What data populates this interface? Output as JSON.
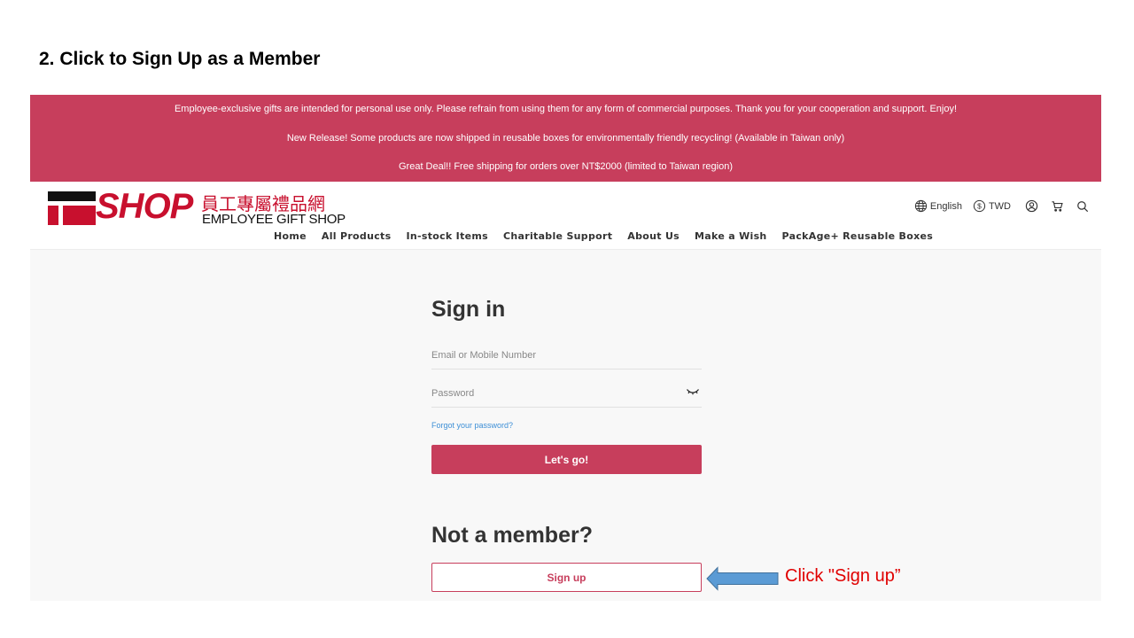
{
  "slide": {
    "title": "2. Click to Sign Up as a Member",
    "callout": "Click \"Sign up”"
  },
  "announcements": [
    "Employee-exclusive gifts are intended for personal use only. Please refrain from using them for any form of commercial purposes. Thank you for your cooperation and support. Enjoy!",
    "New Release! Some products are now shipped in reusable boxes for environmentally friendly recycling! (Available in Taiwan only)",
    "Great Deal!! Free shipping for orders over NT$2000 (limited to Taiwan region)"
  ],
  "header": {
    "logo": {
      "mark_text": "SHOP",
      "cn_text": "員工專屬禮品網",
      "en_text": "EMPLOYEE GIFT SHOP"
    },
    "language": "English",
    "currency": "TWD",
    "icons": [
      "globe-icon",
      "dollar-icon",
      "user-icon",
      "cart-icon",
      "search-icon"
    ]
  },
  "nav": [
    "Home",
    "All Products",
    "In-stock Items",
    "Charitable Support",
    "About Us",
    "Make a Wish",
    "PackAge+ Reusable Boxes"
  ],
  "signin": {
    "title": "Sign in",
    "email_placeholder": "Email or Mobile Number",
    "password_placeholder": "Password",
    "forgot": "Forgot your password?",
    "submit": "Let's go!"
  },
  "signup": {
    "title": "Not a member?",
    "button": "Sign up"
  },
  "colors": {
    "brand": "#c73e5c",
    "logo_red": "#c8102e",
    "link": "#3d8fd6",
    "callout": "#e00000",
    "arrow_fill": "#5b9bd5"
  }
}
